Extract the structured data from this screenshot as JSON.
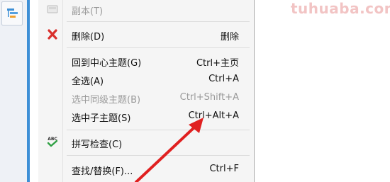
{
  "watermark": "tuhuaba.com",
  "menu": {
    "copy": {
      "label": "副本(T)"
    },
    "delete": {
      "label": "删除(D)",
      "shortcut": "删除"
    },
    "center": {
      "label": "回到中心主题(G)",
      "shortcut": "Ctrl+主页"
    },
    "select_all": {
      "label": "全选(A)",
      "shortcut": "Ctrl+A"
    },
    "select_sibling": {
      "label": "选中同级主题(B)",
      "shortcut": "Ctrl+Shift+A"
    },
    "select_child": {
      "label": "选中子主题(S)",
      "shortcut": "Ctrl+Alt+A"
    },
    "spellcheck": {
      "label": "拼写检查(C)",
      "icon_text": "ABC"
    },
    "find": {
      "label": "查找/替换(F)...",
      "shortcut": "Ctrl+F"
    }
  },
  "colors": {
    "delete_icon": "#d9302c",
    "arrow": "#e02020",
    "check": "#2ea043",
    "accent": "#3d8fd6"
  }
}
